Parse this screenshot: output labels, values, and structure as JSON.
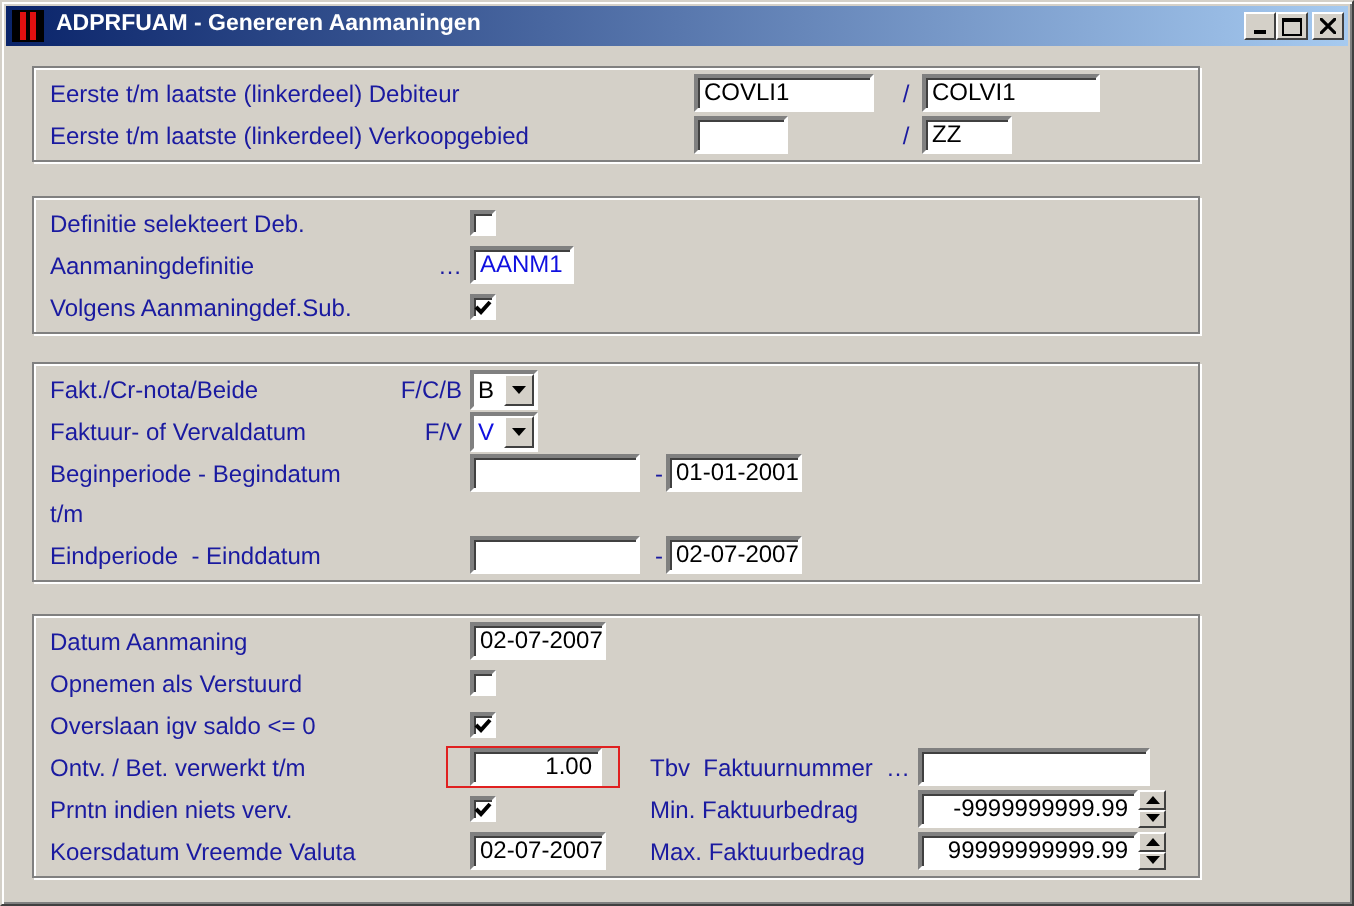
{
  "window": {
    "title": "ADPRFUAM - Genereren Aanmaningen"
  },
  "groups": [
    {
      "rows": [
        {
          "label": "Eerste t/m laatste (linkerdeel) Debiteur",
          "control": {
            "kind": "range",
            "from": "COVLI1",
            "separator": "/",
            "to": "COLVI1"
          }
        },
        {
          "label": "Eerste t/m laatste (linkerdeel) Verkoopgebied",
          "control": {
            "kind": "range",
            "separator": "/",
            "to": "ZZ"
          }
        }
      ]
    },
    {
      "rows": [
        {
          "label": "Definitie selekteert Deb.",
          "control": {
            "kind": "checkbox",
            "checked": false
          }
        },
        {
          "label": "Aanmaningdefinitie",
          "control": {
            "kind": "lookup",
            "prefix": "…",
            "value": "AANM1"
          }
        },
        {
          "label": "Volgens Aanmaningdef.Sub.",
          "control": {
            "kind": "checkbox",
            "checked": true
          }
        }
      ]
    },
    {
      "rows": [
        {
          "label": "Fakt./Cr-nota/Beide",
          "hint": "F/C/B",
          "control": {
            "kind": "combo",
            "value": "B"
          }
        },
        {
          "label": "Faktuur- of Vervaldatum",
          "hint": "F/V",
          "control": {
            "kind": "combo",
            "value": "V"
          }
        },
        {
          "label": "Beginperiode - Begindatum",
          "control": {
            "kind": "range",
            "separator": "-",
            "to": "01-01-2001"
          }
        },
        {
          "label": "t/m"
        },
        {
          "label": "Eindperiode  - Einddatum",
          "control": {
            "kind": "range",
            "separator": "-",
            "to": "02-07-2007"
          }
        }
      ]
    },
    {
      "rows": [
        {
          "label": "Datum Aanmaning",
          "control": {
            "kind": "text",
            "value": "02-07-2007"
          }
        },
        {
          "label": "Opnemen als Verstuurd",
          "control": {
            "kind": "checkbox",
            "checked": false
          }
        },
        {
          "label": "Overslaan igv saldo <= 0",
          "control": {
            "kind": "checkbox",
            "checked": true
          }
        },
        {
          "label": "Ontv. / Bet. verwerkt t/m",
          "control": {
            "kind": "number",
            "value": "1.00",
            "focused": true
          },
          "side": {
            "label": "Tbv  Faktuurnummer",
            "control": {
              "kind": "lookup",
              "prefix": "…"
            }
          }
        },
        {
          "label": "Prntn indien niets verv.",
          "control": {
            "kind": "checkbox",
            "checked": true
          },
          "side": {
            "label": "Min. Faktuurbedrag",
            "control": {
              "kind": "spin",
              "value": "-9999999999.99"
            }
          }
        },
        {
          "label": "Koersdatum Vreemde Valuta",
          "control": {
            "kind": "text",
            "value": "02-07-2007"
          },
          "side": {
            "label": "Max. Faktuurbedrag",
            "control": {
              "kind": "spin",
              "value": "99999999999.99"
            }
          }
        }
      ]
    }
  ]
}
